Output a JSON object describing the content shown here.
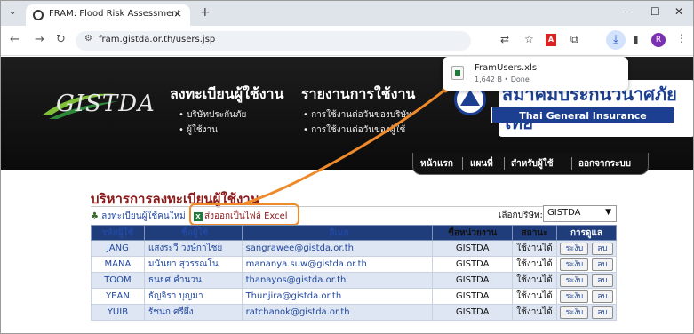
{
  "browser": {
    "tab_title": "FRAM: Flood Risk Assessment",
    "tab_close": "×",
    "new_tab": "+",
    "url": "fram.gistda.or.th/users.jsp",
    "window_controls": [
      "–",
      "☐",
      "✕"
    ],
    "profile_initial": "R",
    "download": {
      "filename": "FramUsers.xls",
      "status": "1,642 B • Done"
    }
  },
  "header": {
    "logo_text": "GISTDA",
    "col1": {
      "title": "ลงทะเบียนผู้ใช้งาน",
      "links": [
        "บริษัทประกันภัย",
        "ผู้ใช้งาน"
      ]
    },
    "col2": {
      "title": "รายงานการใช้งาน",
      "links": [
        "การใช้งานต่อวันของบริษัท",
        "การใช้งานต่อวันของผู้ใช้"
      ]
    },
    "partner_thai": "สมาคมประกันวินาศภัยไทย",
    "partner_eng": "Thai General Insurance Association"
  },
  "nav": {
    "items": [
      "หน้าแรก",
      "แผนที่",
      "สำหรับผู้ใช้",
      "ออกจากระบบ"
    ]
  },
  "main": {
    "title": "บริหารการลงทะเบียนผู้ใช้งาน",
    "register_link": "ลงทะเบียนผู้ใช้คนใหม่",
    "export_link": "ส่งออกเป็นไฟล์ Excel",
    "company_label": "เลือกบริษัท:",
    "company_selected": "GISTDA",
    "table": {
      "headers": [
        "รหัสผู้ใช้",
        "ชื่อผู้ใช้",
        "อีเมล",
        "ชื่อหน่วยงาน",
        "สถานะ",
        "การดูแล"
      ],
      "suspend_label": "ระงับ",
      "delete_label": "ลบ",
      "rows": [
        {
          "id": "JANG",
          "name": "แสงระวี วงษ์กาไชย",
          "email": "sangrawee@gistda.or.th",
          "unit": "GISTDA",
          "status": "ใช้งานได้"
        },
        {
          "id": "MANA",
          "name": "มนันยา สุวรรณโน",
          "email": "mananya.suw@gistda.or.th",
          "unit": "GISTDA",
          "status": "ใช้งานได้"
        },
        {
          "id": "TOOM",
          "name": "ธนยศ คำนวน",
          "email": "thanayos@gistda.or.th",
          "unit": "GISTDA",
          "status": "ใช้งานได้"
        },
        {
          "id": "YEAN",
          "name": "ธัญจิรา บุญมา",
          "email": "Thunjira@gistda.or.th",
          "unit": "GISTDA",
          "status": "ใช้งานได้"
        },
        {
          "id": "YUIB",
          "name": "รัชนก ศรีผึ้ง",
          "email": "ratchanok@gistda.or.th",
          "unit": "GISTDA",
          "status": "ใช้งานได้"
        }
      ]
    }
  },
  "colors": {
    "accent_highlight": "#ef8a2a",
    "title_red": "#8b1a1a",
    "table_header": "#1f3d7a",
    "link_blue": "#2248a0"
  }
}
